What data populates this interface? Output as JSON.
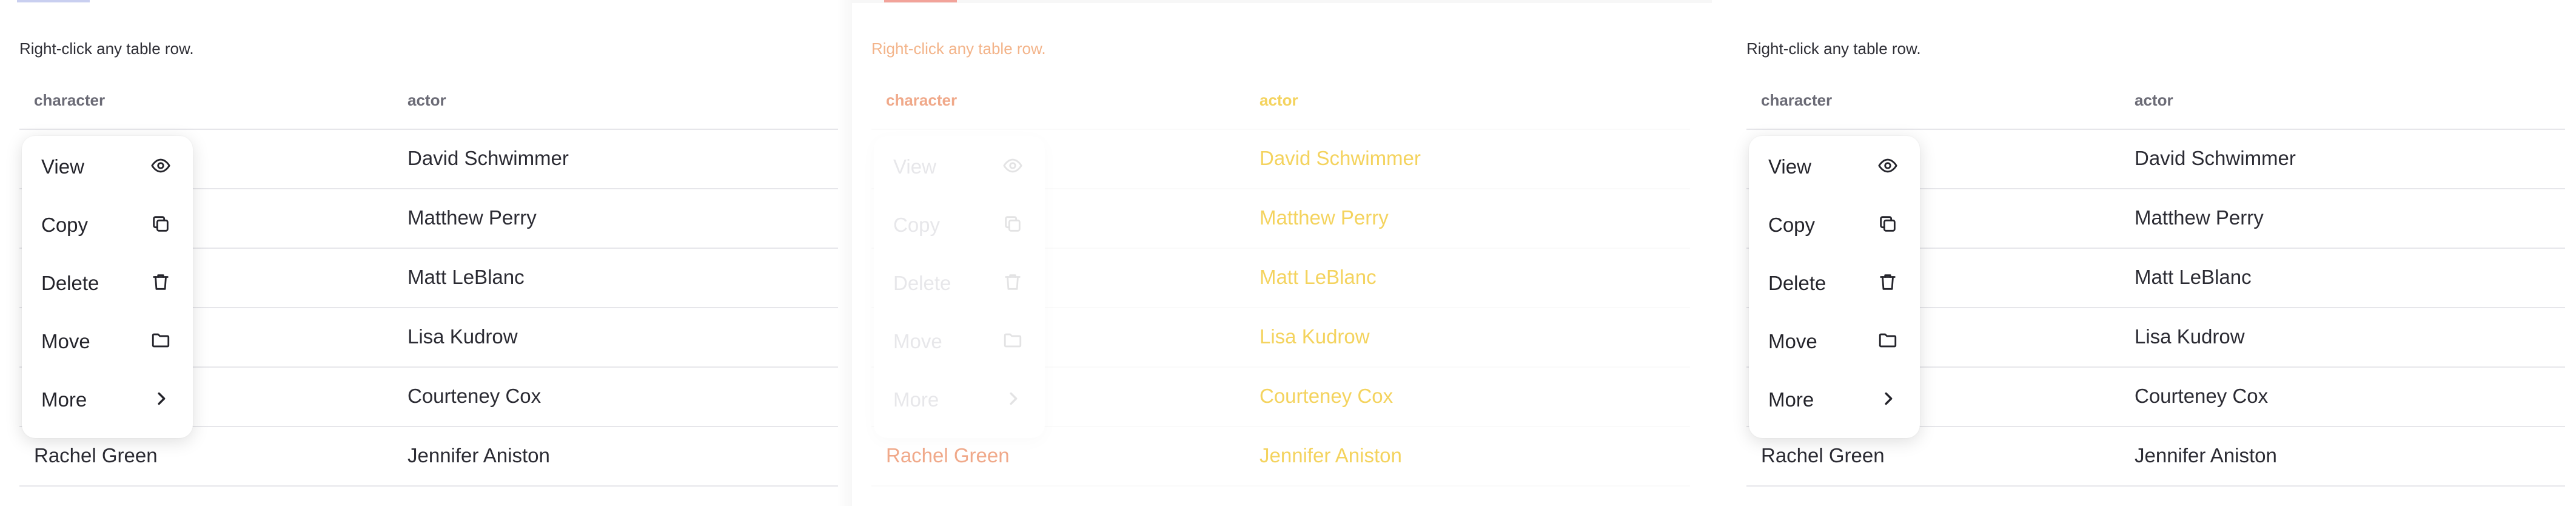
{
  "colors": {
    "accent_blue": "#c9cff0",
    "accent_red": "#f2a39a",
    "faded_actor": "#f4d35e",
    "faded_character": "#f0a98a"
  },
  "panels": [
    {
      "hint": "Right-click any table row.",
      "headers": {
        "character": "character",
        "actor": "actor"
      },
      "rows": [
        {
          "character": "",
          "actor": "David Schwimmer"
        },
        {
          "character": "",
          "actor": "Matthew Perry"
        },
        {
          "character": "",
          "actor": "Matt LeBlanc"
        },
        {
          "character": "",
          "actor": "Lisa Kudrow"
        },
        {
          "character": "",
          "actor": "Courteney Cox"
        },
        {
          "character": "Rachel Green",
          "actor": "Jennifer Aniston"
        }
      ],
      "menu": [
        {
          "label": "View",
          "icon": "eye-icon"
        },
        {
          "label": "Copy",
          "icon": "copy-icon"
        },
        {
          "label": "Delete",
          "icon": "trash-icon"
        },
        {
          "label": "Move",
          "icon": "folder-icon"
        },
        {
          "label": "More",
          "icon": "chevron-right-icon"
        }
      ]
    },
    {
      "hint": "Right-click any table row.",
      "headers": {
        "character": "character",
        "actor": "actor"
      },
      "rows": [
        {
          "character": "",
          "actor": "David Schwimmer"
        },
        {
          "character": "",
          "actor": "Matthew Perry"
        },
        {
          "character": "",
          "actor": "Matt LeBlanc"
        },
        {
          "character": "",
          "actor": "Lisa Kudrow"
        },
        {
          "character": "",
          "actor": "Courteney Cox"
        },
        {
          "character": "Rachel Green",
          "actor": "Jennifer Aniston"
        }
      ],
      "menu": [
        {
          "label": "View",
          "icon": "eye-icon"
        },
        {
          "label": "Copy",
          "icon": "copy-icon"
        },
        {
          "label": "Delete",
          "icon": "trash-icon"
        },
        {
          "label": "Move",
          "icon": "folder-icon"
        },
        {
          "label": "More",
          "icon": "chevron-right-icon"
        }
      ]
    },
    {
      "hint": "Right-click any table row.",
      "headers": {
        "character": "character",
        "actor": "actor"
      },
      "rows": [
        {
          "character": "",
          "actor": "David Schwimmer"
        },
        {
          "character": "",
          "actor": "Matthew Perry"
        },
        {
          "character": "",
          "actor": "Matt LeBlanc"
        },
        {
          "character": "",
          "actor": "Lisa Kudrow"
        },
        {
          "character": "",
          "actor": "Courteney Cox"
        },
        {
          "character": "Rachel Green",
          "actor": "Jennifer Aniston"
        }
      ],
      "menu": [
        {
          "label": "View",
          "icon": "eye-icon"
        },
        {
          "label": "Copy",
          "icon": "copy-icon"
        },
        {
          "label": "Delete",
          "icon": "trash-icon"
        },
        {
          "label": "Move",
          "icon": "folder-icon"
        },
        {
          "label": "More",
          "icon": "chevron-right-icon"
        }
      ]
    }
  ]
}
